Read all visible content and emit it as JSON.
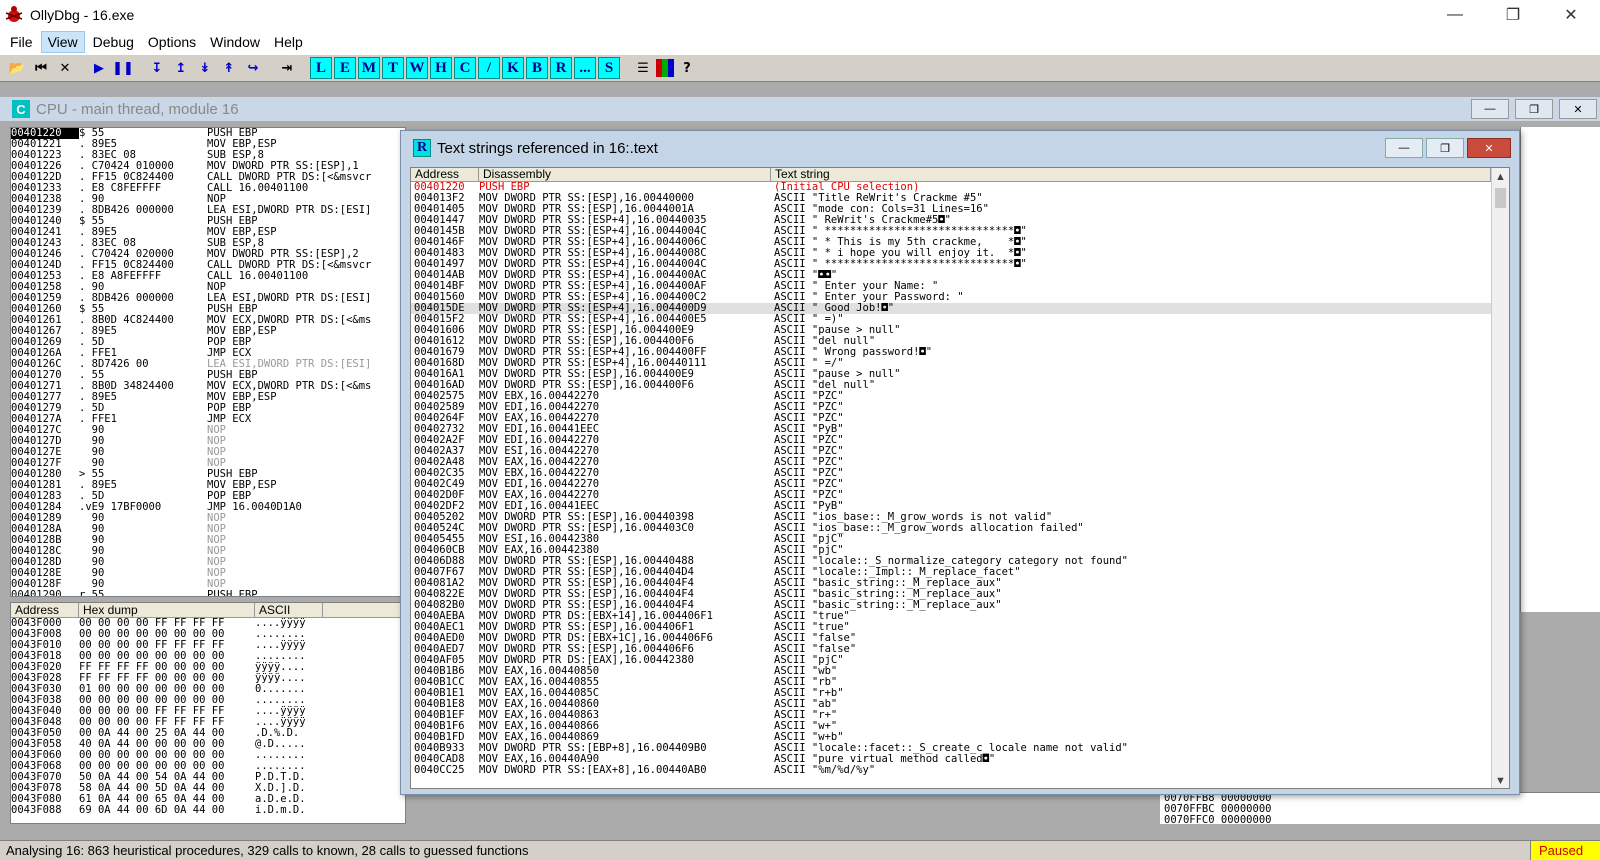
{
  "window": {
    "title": "OllyDbg - 16.exe"
  },
  "menu": [
    "File",
    "View",
    "Debug",
    "Options",
    "Window",
    "Help"
  ],
  "toolbar": {
    "letters": [
      "L",
      "E",
      "M",
      "T",
      "W",
      "H",
      "C",
      "/",
      "K",
      "B",
      "R",
      "...",
      "S"
    ],
    "help": "?"
  },
  "cpu": {
    "title": "CPU - main thread, module 16"
  },
  "disasm": [
    [
      "00401220",
      "$ 55",
      "PUSH EBP"
    ],
    [
      "00401221",
      ". 89E5",
      "MOV EBP,ESP"
    ],
    [
      "00401223",
      ". 83EC 08",
      "SUB ESP,8"
    ],
    [
      "00401226",
      ". C70424 010000",
      "MOV DWORD PTR SS:[ESP],1"
    ],
    [
      "0040122D",
      ". FF15 0C824400",
      "CALL DWORD PTR DS:[<&msvcr"
    ],
    [
      "00401233",
      ". E8 C8FEFFFF",
      "CALL 16.00401100"
    ],
    [
      "00401238",
      ". 90",
      "NOP"
    ],
    [
      "00401239",
      ". 8DB426 000000",
      "LEA ESI,DWORD PTR DS:[ESI]"
    ],
    [
      "00401240",
      "$ 55",
      "PUSH EBP"
    ],
    [
      "00401241",
      ". 89E5",
      "MOV EBP,ESP"
    ],
    [
      "00401243",
      ". 83EC 08",
      "SUB ESP,8"
    ],
    [
      "00401246",
      ". C70424 020000",
      "MOV DWORD PTR SS:[ESP],2"
    ],
    [
      "0040124D",
      ". FF15 0C824400",
      "CALL DWORD PTR DS:[<&msvcr"
    ],
    [
      "00401253",
      ". E8 A8FEFFFF",
      "CALL 16.00401100"
    ],
    [
      "00401258",
      ". 90",
      "NOP"
    ],
    [
      "00401259",
      ". 8DB426 000000",
      "LEA ESI,DWORD PTR DS:[ESI]"
    ],
    [
      "00401260",
      "$ 55",
      "PUSH EBP"
    ],
    [
      "00401261",
      ". 8B0D 4C824400",
      "MOV ECX,DWORD PTR DS:[<&ms"
    ],
    [
      "00401267",
      ". 89E5",
      "MOV EBP,ESP"
    ],
    [
      "00401269",
      ". 5D",
      "POP EBP"
    ],
    [
      "0040126A",
      ". FFE1",
      "JMP ECX"
    ],
    [
      "0040126C",
      ". 8D7426 00",
      "LEA ESI,DWORD PTR DS:[ESI]"
    ],
    [
      "00401270",
      ". 55",
      "PUSH EBP"
    ],
    [
      "00401271",
      ". 8B0D 34824400",
      "MOV ECX,DWORD PTR DS:[<&ms"
    ],
    [
      "00401277",
      ". 89E5",
      "MOV EBP,ESP"
    ],
    [
      "00401279",
      ". 5D",
      "POP EBP"
    ],
    [
      "0040127A",
      ". FFE1",
      "JMP ECX"
    ],
    [
      "0040127C",
      "  90",
      "NOP"
    ],
    [
      "0040127D",
      "  90",
      "NOP"
    ],
    [
      "0040127E",
      "  90",
      "NOP"
    ],
    [
      "0040127F",
      "  90",
      "NOP"
    ],
    [
      "00401280",
      "> 55",
      "PUSH EBP"
    ],
    [
      "00401281",
      ". 89E5",
      "MOV EBP,ESP"
    ],
    [
      "00401283",
      ". 5D",
      "POP EBP"
    ],
    [
      "00401284",
      ".vE9 17BF0000",
      "JMP 16.0040D1A0"
    ],
    [
      "00401289",
      "  90",
      "NOP"
    ],
    [
      "0040128A",
      "  90",
      "NOP"
    ],
    [
      "0040128B",
      "  90",
      "NOP"
    ],
    [
      "0040128C",
      "  90",
      "NOP"
    ],
    [
      "0040128D",
      "  90",
      "NOP"
    ],
    [
      "0040128E",
      "  90",
      "NOP"
    ],
    [
      "0040128F",
      "  90",
      "NOP"
    ],
    [
      "00401290",
      "r 55",
      "PUSH EBP"
    ]
  ],
  "hexdump": {
    "headers": [
      "Address",
      "Hex dump",
      "ASCII"
    ],
    "rows": [
      [
        "0043F000",
        "00 00 00 00 FF FF FF FF",
        "....ÿÿÿÿ"
      ],
      [
        "0043F008",
        "00 00 00 00 00 00 00 00",
        "........"
      ],
      [
        "0043F010",
        "00 00 00 00 FF FF FF FF",
        "....ÿÿÿÿ"
      ],
      [
        "0043F018",
        "00 00 00 00 00 00 00 00",
        "........"
      ],
      [
        "0043F020",
        "FF FF FF FF 00 00 00 00",
        "ÿÿÿÿ...."
      ],
      [
        "0043F028",
        "FF FF FF FF 00 00 00 00",
        "ÿÿÿÿ...."
      ],
      [
        "0043F030",
        "01 00 00 00 00 00 00 00",
        "0......."
      ],
      [
        "0043F038",
        "00 00 00 00 00 00 00 00",
        "........"
      ],
      [
        "0043F040",
        "00 00 00 00 FF FF FF FF",
        "....ÿÿÿÿ"
      ],
      [
        "0043F048",
        "00 00 00 00 FF FF FF FF",
        "....ÿÿÿÿ"
      ],
      [
        "0043F050",
        "00 0A 44 00 25 0A 44 00",
        ".D.%.D."
      ],
      [
        "0043F058",
        "40 0A 44 00 00 00 00 00",
        "@.D....."
      ],
      [
        "0043F060",
        "00 00 00 00 00 00 00 00",
        "........"
      ],
      [
        "0043F068",
        "00 00 00 00 00 00 00 00",
        "........"
      ],
      [
        "0043F070",
        "50 0A 44 00 54 0A 44 00",
        "P.D.T.D."
      ],
      [
        "0043F078",
        "58 0A 44 00 5D 0A 44 00",
        "X.D.].D."
      ],
      [
        "0043F080",
        "61 0A 44 00 65 0A 44 00",
        "a.D.e.D."
      ],
      [
        "0043F088",
        "69 0A 44 00 6D 0A 44 00",
        "i.D.m.D."
      ]
    ]
  },
  "stack": [
    "0070FFB8 00000000",
    "0070FFBC 00000000",
    "0070FFC0 00000000"
  ],
  "strings_window": {
    "title": "Text strings referenced in 16:.text",
    "headers": [
      "Address",
      "Disassembly",
      "Text string"
    ],
    "rows": [
      [
        "00401220",
        "PUSH EBP",
        "(Initial CPU selection)"
      ],
      [
        "004013F2",
        "MOV DWORD PTR SS:[ESP],16.00440000",
        "ASCII \"Title ReWrit's Crackme #5\""
      ],
      [
        "00401405",
        "MOV DWORD PTR SS:[ESP],16.0044001A",
        "ASCII \"mode con: Cols=31 Lines=16\""
      ],
      [
        "00401447",
        "MOV DWORD PTR SS:[ESP+4],16.00440035",
        "ASCII \" ReWrit's Crackme#5◘\""
      ],
      [
        "0040145B",
        "MOV DWORD PTR SS:[ESP+4],16.0044004C",
        "ASCII \" ******************************◘\""
      ],
      [
        "0040146F",
        "MOV DWORD PTR SS:[ESP+4],16.0044006C",
        "ASCII \" * This is my 5th crackme,    *◘\""
      ],
      [
        "00401483",
        "MOV DWORD PTR SS:[ESP+4],16.0044008C",
        "ASCII \" * i hope you will enjoy it.  *◘\""
      ],
      [
        "00401497",
        "MOV DWORD PTR SS:[ESP+4],16.0044004C",
        "ASCII \" ******************************◘\""
      ],
      [
        "004014AB",
        "MOV DWORD PTR SS:[ESP+4],16.004400AC",
        "ASCII \"◘◘\""
      ],
      [
        "004014BF",
        "MOV DWORD PTR SS:[ESP+4],16.004400AF",
        "ASCII \" Enter your Name: \""
      ],
      [
        "00401560",
        "MOV DWORD PTR SS:[ESP+4],16.004400C2",
        "ASCII \" Enter your Password: \""
      ],
      [
        "004015DE",
        "MOV DWORD PTR SS:[ESP+4],16.004400D9",
        "ASCII \" Good Job!◘\""
      ],
      [
        "004015F2",
        "MOV DWORD PTR SS:[ESP+4],16.004400E5",
        "ASCII \" =)\""
      ],
      [
        "00401606",
        "MOV DWORD PTR SS:[ESP],16.004400E9",
        "ASCII \"pause > null\""
      ],
      [
        "00401612",
        "MOV DWORD PTR SS:[ESP],16.004400F6",
        "ASCII \"del null\""
      ],
      [
        "00401679",
        "MOV DWORD PTR SS:[ESP+4],16.004400FF",
        "ASCII \" Wrong password!◘\""
      ],
      [
        "0040168D",
        "MOV DWORD PTR SS:[ESP+4],16.00440111",
        "ASCII \" =/\""
      ],
      [
        "004016A1",
        "MOV DWORD PTR SS:[ESP],16.004400E9",
        "ASCII \"pause > null\""
      ],
      [
        "004016AD",
        "MOV DWORD PTR SS:[ESP],16.004400F6",
        "ASCII \"del null\""
      ],
      [
        "00402575",
        "MOV EBX,16.00442270",
        "ASCII \"PZC\""
      ],
      [
        "00402589",
        "MOV EDI,16.00442270",
        "ASCII \"PZC\""
      ],
      [
        "0040264F",
        "MOV EAX,16.00442270",
        "ASCII \"PZC\""
      ],
      [
        "00402732",
        "MOV EDI,16.00441EEC",
        "ASCII \"PyB\""
      ],
      [
        "00402A2F",
        "MOV EDI,16.00442270",
        "ASCII \"PZC\""
      ],
      [
        "00402A37",
        "MOV ESI,16.00442270",
        "ASCII \"PZC\""
      ],
      [
        "00402A48",
        "MOV EAX,16.00442270",
        "ASCII \"PZC\""
      ],
      [
        "00402C35",
        "MOV EBX,16.00442270",
        "ASCII \"PZC\""
      ],
      [
        "00402C49",
        "MOV EDI,16.00442270",
        "ASCII \"PZC\""
      ],
      [
        "00402D0F",
        "MOV EAX,16.00442270",
        "ASCII \"PZC\""
      ],
      [
        "00402DF2",
        "MOV EDI,16.00441EEC",
        "ASCII \"PyB\""
      ],
      [
        "00405202",
        "MOV DWORD PTR SS:[ESP],16.00440398",
        "ASCII \"ios_base::_M_grow_words is not valid\""
      ],
      [
        "0040524C",
        "MOV DWORD PTR SS:[ESP],16.004403C0",
        "ASCII \"ios_base::_M_grow_words allocation failed\""
      ],
      [
        "00405455",
        "MOV ESI,16.00442380",
        "ASCII \"pjC\""
      ],
      [
        "004060CB",
        "MOV EAX,16.00442380",
        "ASCII \"pjC\""
      ],
      [
        "00406D88",
        "MOV DWORD PTR SS:[ESP],16.00440488",
        "ASCII \"locale::_S_normalize_category category not found\""
      ],
      [
        "00407F67",
        "MOV DWORD PTR SS:[ESP],16.004404D4",
        "ASCII \"locale::_Impl::_M_replace_facet\""
      ],
      [
        "004081A2",
        "MOV DWORD PTR SS:[ESP],16.004404F4",
        "ASCII \"basic_string::_M_replace_aux\""
      ],
      [
        "0040822E",
        "MOV DWORD PTR SS:[ESP],16.004404F4",
        "ASCII \"basic_string::_M_replace_aux\""
      ],
      [
        "004082B0",
        "MOV DWORD PTR SS:[ESP],16.004404F4",
        "ASCII \"basic_string::_M_replace_aux\""
      ],
      [
        "0040AEBA",
        "MOV DWORD PTR DS:[EBX+14],16.004406F1",
        "ASCII \"true\""
      ],
      [
        "0040AEC1",
        "MOV DWORD PTR SS:[ESP],16.004406F1",
        "ASCII \"true\""
      ],
      [
        "0040AED0",
        "MOV DWORD PTR DS:[EBX+1C],16.004406F6",
        "ASCII \"false\""
      ],
      [
        "0040AED7",
        "MOV DWORD PTR SS:[ESP],16.004406F6",
        "ASCII \"false\""
      ],
      [
        "0040AF05",
        "MOV DWORD PTR DS:[EAX],16.00442380",
        "ASCII \"pjC\""
      ],
      [
        "0040B1B6",
        "MOV EAX,16.00440850",
        "ASCII \"wb\""
      ],
      [
        "0040B1CC",
        "MOV EAX,16.00440855",
        "ASCII \"rb\""
      ],
      [
        "0040B1E1",
        "MOV EAX,16.0044085C",
        "ASCII \"r+b\""
      ],
      [
        "0040B1E8",
        "MOV EAX,16.00440860",
        "ASCII \"ab\""
      ],
      [
        "0040B1EF",
        "MOV EAX,16.00440863",
        "ASCII \"r+\""
      ],
      [
        "0040B1F6",
        "MOV EAX,16.00440866",
        "ASCII \"w+\""
      ],
      [
        "0040B1FD",
        "MOV EAX,16.00440869",
        "ASCII \"w+b\""
      ],
      [
        "0040B933",
        "MOV DWORD PTR SS:[EBP+8],16.004409B0",
        "ASCII \"locale::facet::_S_create_c_locale name not valid\""
      ],
      [
        "0040CAD8",
        "MOV EAX,16.00440A90",
        "ASCII \"pure virtual method called◘\""
      ],
      [
        "0040CC25",
        "MOV DWORD PTR SS:[EAX+8],16.00440AB0",
        "ASCII \"%m/%d/%y\""
      ]
    ]
  },
  "status": {
    "message": "Analysing 16: 863 heuristical procedures, 329 calls to known, 28 calls to guessed functions",
    "state": "Paused"
  }
}
